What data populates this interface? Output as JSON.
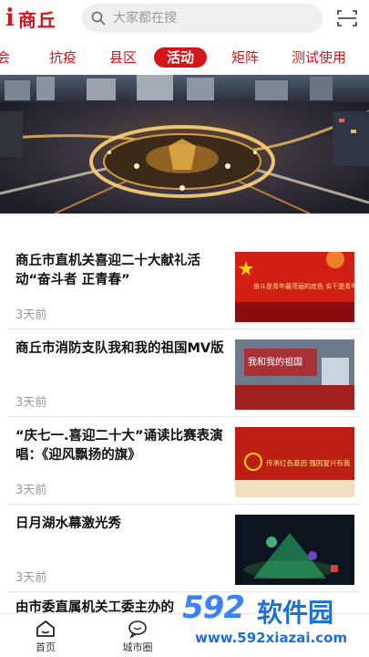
{
  "header": {
    "logo_text": "商丘",
    "search_placeholder": "大家都在搜"
  },
  "tabs": [
    {
      "label": "会"
    },
    {
      "label": "抗疫"
    },
    {
      "label": "县区"
    },
    {
      "label": "活动",
      "active": true
    },
    {
      "label": "矩阵"
    },
    {
      "label": "测试使用"
    }
  ],
  "news": [
    {
      "title": "商丘市直机关喜迎二十大献礼活动“奋斗者 正青春”",
      "time": "3天前",
      "thumb_caption": "奋斗是青年最亮丽的底色 实干是青年最可敬的姿态"
    },
    {
      "title": "商丘市消防支队我和我的祖国MV版",
      "time": "3天前",
      "thumb_caption": "我和我的祖国"
    },
    {
      "title": "“庆七一.喜迎二十大”诵读比赛表演唱：《迎风飘扬的旗》",
      "time": "3天前",
      "thumb_caption": "传承红色基因 强国复兴有我"
    },
    {
      "title": "日月湖水幕激光秀",
      "time": "3天前",
      "thumb_caption": ""
    },
    {
      "title": "由市委直属机关工委主办的",
      "time": "",
      "thumb_caption": ""
    }
  ],
  "bottom_nav": [
    {
      "label": "首页",
      "icon": "home-icon"
    },
    {
      "label": "城市圈",
      "icon": "chat-icon"
    }
  ],
  "watermark": {
    "number": "592",
    "name": "软件园",
    "url": "www.592xiazai.com"
  },
  "colors": {
    "brand_red": "#d7141a",
    "watermark_blue": "#1e6fd9"
  }
}
